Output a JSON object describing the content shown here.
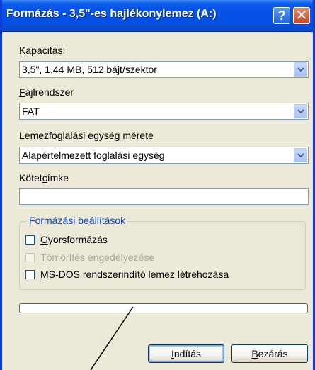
{
  "window": {
    "title": "Formázás - 3,5\"-es hajlékonylemez (A:)",
    "help_icon": "question-icon",
    "close_icon": "close-icon"
  },
  "capacity": {
    "label_prefix": "",
    "label_accel": "K",
    "label_rest": "apacitás:",
    "value": "3,5\",  1,44 MB, 512 bájt/szektor"
  },
  "filesystem": {
    "label_accel": "F",
    "label_rest": "ájlrendszer",
    "value": "FAT"
  },
  "allocation": {
    "label_pre": "Lemezfoglalási ",
    "label_accel": "e",
    "label_rest": "gység mérete",
    "value": "Alapértelmezett foglalási egység"
  },
  "volume_label": {
    "label_pre": "Kötet",
    "label_accel": "c",
    "label_rest": "ímke",
    "value": ""
  },
  "format_options": {
    "title_accel": "F",
    "title_rest": "ormázási beállítások",
    "quick_format": {
      "accel": "G",
      "rest": "yorsformázás",
      "checked": false,
      "enabled": true
    },
    "compression": {
      "accel": "T",
      "rest": "ömörítés engedélyezése",
      "checked": false,
      "enabled": false
    },
    "msdos_boot": {
      "accel": "M",
      "rest": "S-DOS rendszerindító lemez létrehozása",
      "checked": false,
      "enabled": true
    }
  },
  "progress": {
    "fraction": 0.0
  },
  "buttons": {
    "start": {
      "accel": "I",
      "rest": "ndítás"
    },
    "close": {
      "accel": "B",
      "rest": "ezárás"
    }
  },
  "colors": {
    "title_bar": "#0451e4",
    "dialog_bg": "#ece9d8",
    "group_title": "#0046d5",
    "close_button": "#c94622"
  }
}
